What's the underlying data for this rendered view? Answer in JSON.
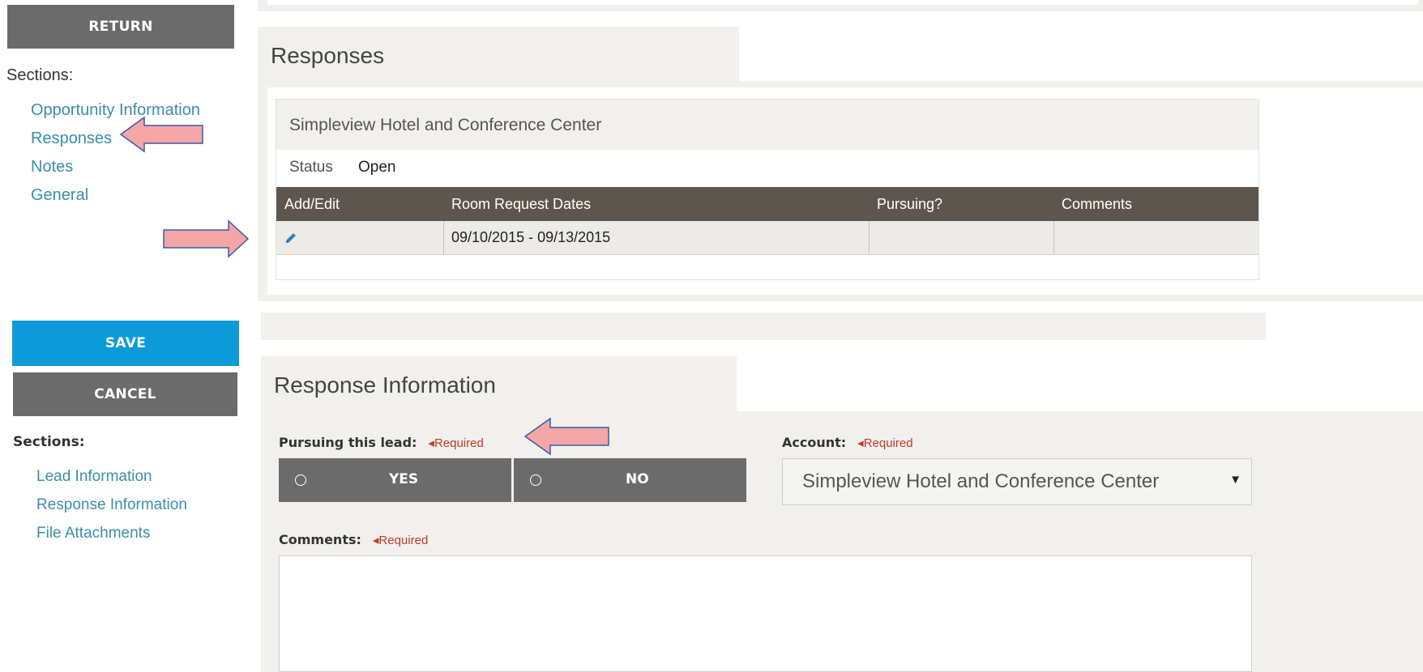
{
  "left_top": {
    "return_label": "RETURN",
    "sections_label": "Sections:",
    "links": [
      "Opportunity Information",
      "Responses",
      "Notes",
      "General"
    ]
  },
  "left_bottom": {
    "save_label": "SAVE",
    "cancel_label": "CANCEL",
    "sections_label": "Sections:",
    "links": [
      "Lead Information",
      "Response Information",
      "File Attachments"
    ]
  },
  "responses": {
    "title": "Responses",
    "hotel_name": "Simpleview Hotel and Conference Center",
    "status_label": "Status",
    "status_value": "Open",
    "columns": [
      "Add/Edit",
      "Room Request Dates",
      "Pursuing?",
      "Comments"
    ],
    "rows": [
      {
        "dates": "09/10/2015 - 09/13/2015",
        "pursuing": "",
        "comments": ""
      }
    ],
    "edit_icon": "pencil-icon"
  },
  "response_info": {
    "title": "Response Information",
    "pursuing_label": "Pursuing this lead:",
    "required_text": "◂Required",
    "yes_label": "YES",
    "no_label": "NO",
    "account_label": "Account:",
    "account_value": "Simpleview Hotel and Conference Center",
    "comments_label": "Comments:",
    "comments_value": ""
  },
  "colors": {
    "accent_blue": "#0d9ad9",
    "button_gray": "#6b6b6b",
    "table_header": "#5d564f",
    "link": "#3a8fa6",
    "required_red": "#c0392b",
    "arrow_fill": "#f4a6a6",
    "arrow_stroke": "#3b5aa8"
  }
}
